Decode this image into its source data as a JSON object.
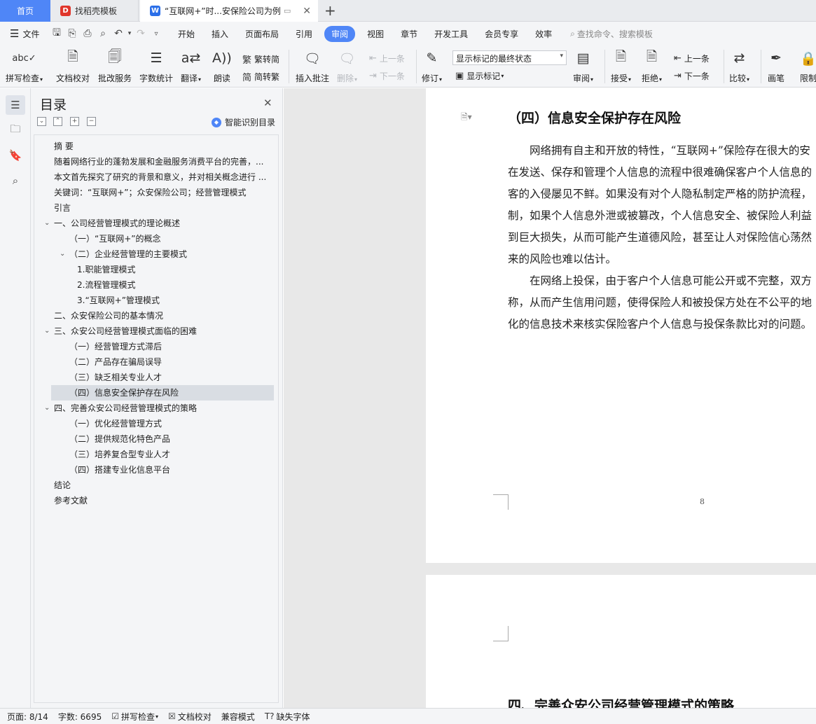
{
  "tabs": {
    "home": "首页",
    "template": "找稻壳模板",
    "document": "“互联网+”时...安保险公司为例",
    "template_icon": "wps-docer-icon",
    "document_icon": "wps-writer-icon"
  },
  "menu": {
    "file": "文件",
    "items": [
      "开始",
      "插入",
      "页面布局",
      "引用",
      "审阅",
      "视图",
      "章节",
      "开发工具",
      "会员专享",
      "效率"
    ],
    "active": "审阅",
    "search_placeholder": "查找命令、搜索模板"
  },
  "ribbon": {
    "spell_check": "拼写检查",
    "doc_proof": "文档校对",
    "batch_service": "批改服务",
    "word_count": "字数统计",
    "translate": "翻译",
    "read_aloud": "朗读",
    "trad_to_simp": "繁转简",
    "simp_to_trad": "简转繁",
    "insert_comment": "插入批注",
    "delete": "删除",
    "prev_item": "上一条",
    "next_item": "下一条",
    "track_changes": "修订",
    "markup_state": "显示标记的最终状态",
    "show_markup": "显示标记",
    "review": "审阅",
    "accept": "接受",
    "reject": "拒绝",
    "prev_change": "上一条",
    "next_change": "下一条",
    "compare": "比较",
    "pen": "画笔",
    "restrict": "限制"
  },
  "toc": {
    "title": "目录",
    "smart_detect": "智能识别目录",
    "items": [
      {
        "label": "摘  要",
        "level": 0,
        "chevron": false
      },
      {
        "label": "随着网络行业的蓬勃发展和金融服务消费平台的完善，...",
        "level": 0,
        "chevron": false
      },
      {
        "label": "本文首先探究了研究的背景和意义，并对相关概念进行 ...",
        "level": 0,
        "chevron": false
      },
      {
        "label": "关键词：“互联网+”；众安保险公司；经营管理模式",
        "level": 0,
        "chevron": false
      },
      {
        "label": "引言",
        "level": 0,
        "chevron": false
      },
      {
        "label": "一、公司经营管理模式的理论概述",
        "level": 0,
        "chevron": true
      },
      {
        "label": "（一）“互联网+”的概念",
        "level": 1,
        "chevron": false
      },
      {
        "label": "（二）企业经营管理的主要模式",
        "level": 1,
        "chevron": true
      },
      {
        "label": "1.职能管理模式",
        "level": 2,
        "chevron": false
      },
      {
        "label": "2.流程管理模式",
        "level": 2,
        "chevron": false
      },
      {
        "label": "3.“互联网+”管理模式",
        "level": 2,
        "chevron": false
      },
      {
        "label": "二、众安保险公司的基本情况",
        "level": 0,
        "chevron": false
      },
      {
        "label": "三、众安公司经营管理模式面临的困难",
        "level": 0,
        "chevron": true
      },
      {
        "label": "（一）经营管理方式滞后",
        "level": 1,
        "chevron": false
      },
      {
        "label": "（二）产品存在骗局误导",
        "level": 1,
        "chevron": false
      },
      {
        "label": "（三）缺乏相关专业人才",
        "level": 1,
        "chevron": false
      },
      {
        "label": "（四）信息安全保护存在风险",
        "level": 1,
        "chevron": false,
        "selected": true
      },
      {
        "label": "四、完善众安公司经营管理模式的策略",
        "level": 0,
        "chevron": true
      },
      {
        "label": "（一）优化经营管理方式",
        "level": 1,
        "chevron": false
      },
      {
        "label": "（二）提供规范化特色产品",
        "level": 1,
        "chevron": false
      },
      {
        "label": "（三）培养复合型专业人才",
        "level": 1,
        "chevron": false
      },
      {
        "label": "（四）搭建专业化信息平台",
        "level": 1,
        "chevron": false
      },
      {
        "label": "结论",
        "level": 0,
        "chevron": false
      },
      {
        "label": "参考文献",
        "level": 0,
        "chevron": false
      }
    ]
  },
  "document": {
    "heading": "（四）信息安全保护存在风险",
    "lines": [
      "　　网络拥有自主和开放的特性，“互联网+”保险存在很大的安",
      "在发送、保存和管理个人信息的流程中很难确保客户个人信息的",
      "客的入侵屡见不鲜。如果没有对个人隐私制定严格的防护流程，",
      "制，如果个人信息外泄或被篡改，个人信息安全、被保险人利益",
      "到巨大损失，从而可能产生道德风险，甚至让人对保险信心荡然",
      "来的风险也难以估计。",
      "　　在网络上投保，由于客户个人信息可能公开或不完整，双方",
      "称，从而产生信用问题，使得保险人和被投保方处在不公平的地",
      "化的信息技术来核实保险客户个人信息与投保条款比对的问题。"
    ],
    "page_number": "8",
    "next_heading": "四、完善众安公司经营管理模式的策略"
  },
  "status": {
    "page": "页面: 8/14",
    "word_count": "字数: 6695",
    "spell_check": "拼写检查",
    "doc_proof": "文档校对",
    "compat_mode": "兼容模式",
    "missing_fonts": "缺失字体"
  },
  "colors": {
    "accent": "#4f86f7",
    "selected_row": "#d9dde3"
  }
}
